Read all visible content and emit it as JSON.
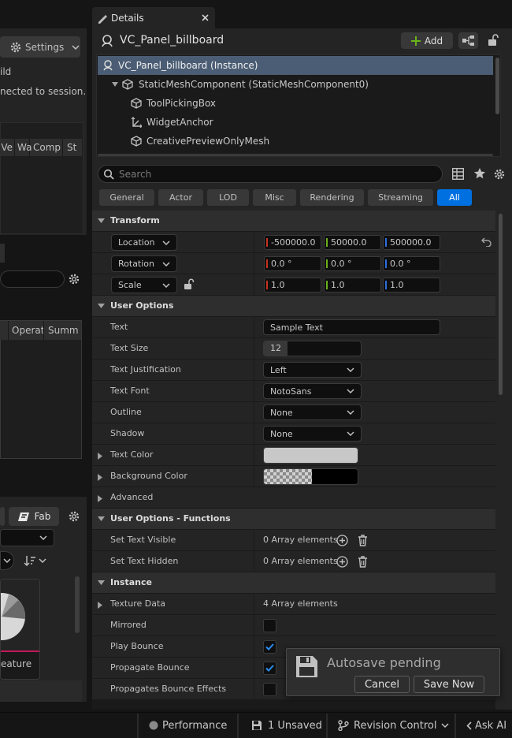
{
  "left": {
    "settings_label": "Settings",
    "msg1": "ild",
    "msg2": "nected to session.",
    "cols1": [
      "Ve",
      "Wa",
      "Comp",
      "St"
    ],
    "cols2": [
      "Operat",
      "Summ"
    ],
    "fab_label": "Fab",
    "thumb_label": "eature"
  },
  "details": {
    "tab_title": "Details",
    "object_name": "VC_Panel_billboard",
    "add_label": "Add",
    "tree": [
      "VC_Panel_billboard (Instance)",
      "StaticMeshComponent (StaticMeshComponent0)",
      "ToolPickingBox",
      "WidgetAnchor",
      "CreativePreviewOnlyMesh"
    ],
    "search_placeholder": "Search",
    "filters": [
      "General",
      "Actor",
      "LOD",
      "Misc",
      "Rendering",
      "Streaming",
      "All"
    ],
    "sections": {
      "transform": "Transform",
      "user_options": "User Options",
      "user_options_functions": "User Options - Functions",
      "instance": "Instance"
    },
    "transform": {
      "location": {
        "label": "Location",
        "values": [
          "-500000.0",
          "50000.0",
          "500000.0"
        ]
      },
      "rotation": {
        "label": "Rotation",
        "values": [
          "0.0 °",
          "0.0 °",
          "0.0 °"
        ]
      },
      "scale": {
        "label": "Scale",
        "values": [
          "1.0",
          "1.0",
          "1.0"
        ]
      }
    },
    "user_options": {
      "text": {
        "label": "Text",
        "value": "Sample Text"
      },
      "text_size": {
        "label": "Text Size",
        "value": "12"
      },
      "text_justification": {
        "label": "Text Justification",
        "value": "Left"
      },
      "text_font": {
        "label": "Text Font",
        "value": "NotoSans"
      },
      "outline": {
        "label": "Outline",
        "value": "None"
      },
      "shadow": {
        "label": "Shadow",
        "value": "None"
      },
      "text_color": {
        "label": "Text Color",
        "color": "#c8c8c8"
      },
      "background_color": {
        "label": "Background Color",
        "color": "#000000"
      },
      "advanced": {
        "label": "Advanced"
      }
    },
    "functions": {
      "set_text_visible": {
        "label": "Set Text Visible",
        "value": "0 Array elements"
      },
      "set_text_hidden": {
        "label": "Set Text Hidden",
        "value": "0 Array elements"
      }
    },
    "instance": {
      "texture_data": {
        "label": "Texture Data",
        "value": "4 Array elements"
      },
      "mirrored": {
        "label": "Mirrored",
        "checked": false
      },
      "play_bounce": {
        "label": "Play Bounce",
        "checked": true
      },
      "propagate_bounce": {
        "label": "Propagate Bounce",
        "checked": true
      },
      "propagates_bounce_effects": {
        "label": "Propagates Bounce Effects",
        "checked": false
      }
    }
  },
  "autosave": {
    "title": "Autosave pending",
    "cancel_label": "Cancel",
    "save_label": "Save Now"
  },
  "statusbar": {
    "performance": "Performance",
    "unsaved": "1 Unsaved",
    "revision_control": "Revision Control",
    "ask_ai": "Ask AI"
  },
  "colors": {
    "accent": "#0070e0",
    "x_axis": "#c8321e",
    "y_axis": "#6ab21a",
    "z_axis": "#2a6fe0"
  }
}
